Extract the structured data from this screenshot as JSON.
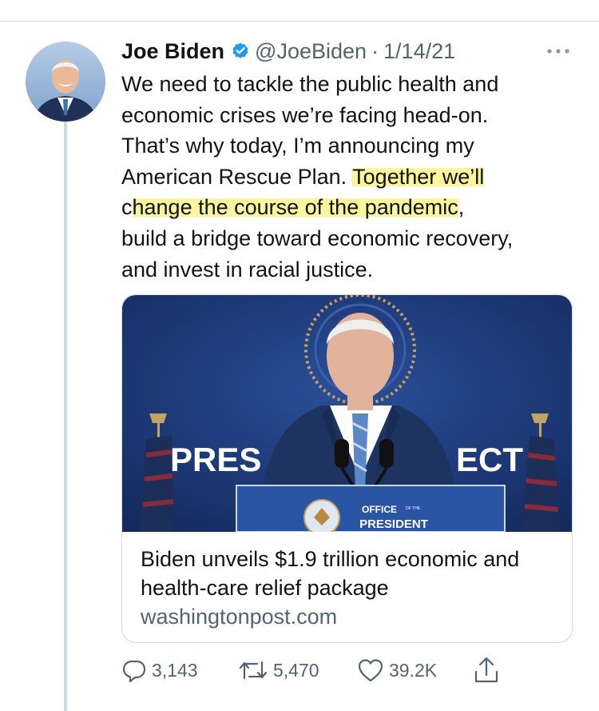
{
  "tweet": {
    "author_name": "Joe Biden",
    "handle": "@JoeBiden",
    "separator": "·",
    "date": "1/14/21",
    "text_lines": [
      "We need to tackle the public health and",
      "economic crises we’re facing head-on.",
      "That’s why today, I’m announcing my",
      "American Rescue Plan. ",
      "Together we’ll",
      "c",
      "hange the course of the pandemic",
      ",",
      "build a bridge toward economic recovery,",
      "and invest in racial justice."
    ]
  },
  "link_card": {
    "image_text": {
      "banner_left": "PRES",
      "banner_right": "ECT",
      "podium_line1": "OFFICE",
      "podium_of_the": "OF THE",
      "podium_line2": "PRESIDENT"
    },
    "title": "Biden unveils $1.9 trillion economic and health-care relief package",
    "domain": "washingtonpost.com"
  },
  "actions": {
    "reply_count": "3,143",
    "retweet_count": "5,470",
    "like_count": "39.2K"
  },
  "colors": {
    "text": "#0f1419",
    "secondary": "#536471",
    "verified": "#1d9bf0",
    "highlight": "#fbf69e",
    "border": "#cfd9de"
  },
  "icons": [
    "verified-badge-icon",
    "more-icon",
    "reply-icon",
    "retweet-icon",
    "like-icon",
    "share-icon"
  ]
}
